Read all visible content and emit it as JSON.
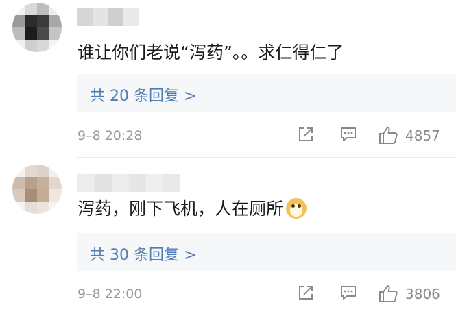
{
  "comments": [
    {
      "text": "谁让你们老说“泻药”。。求仁得仁了",
      "replies_label": "共 20 条回复 >",
      "time": "9–8 20:28",
      "like_count": "4857"
    },
    {
      "text": "泻药，刚下飞机，人在厕所",
      "emoji": "doge-emoji",
      "replies_label": "共 30 条回复 >",
      "time": "9–8 22:00",
      "like_count": "3806"
    }
  ],
  "icons": {
    "share": "share-icon",
    "comment": "comment-icon",
    "like": "thumbs-up-icon"
  },
  "colors": {
    "link": "#4f7db5",
    "reply_bg": "#f6f7f9",
    "meta": "#9a9a9a"
  }
}
